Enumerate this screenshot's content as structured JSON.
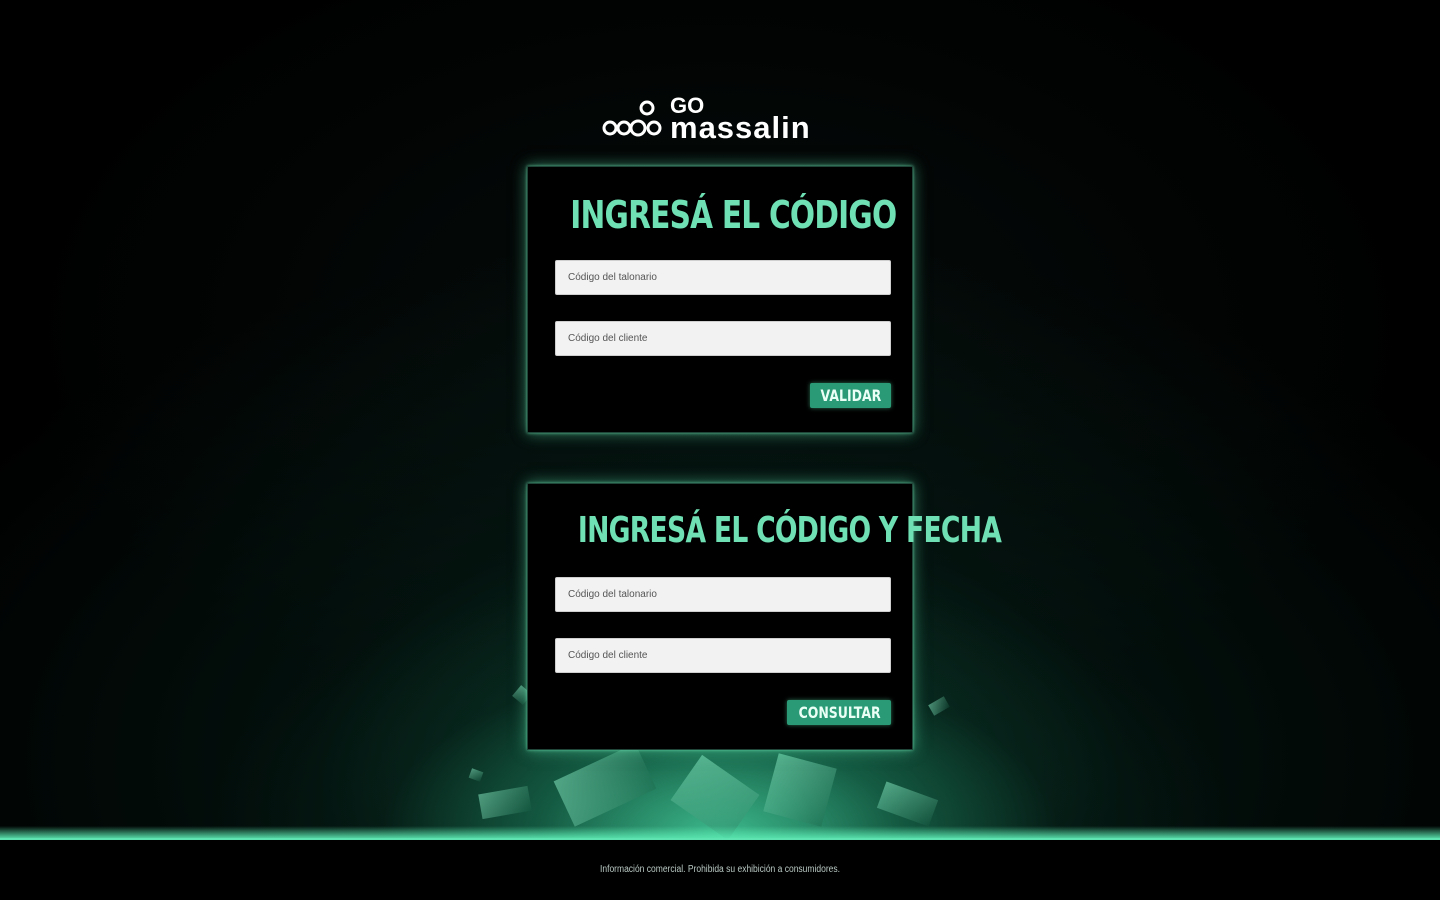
{
  "brand": {
    "logo_top": "GO",
    "logo_bottom": "massalin"
  },
  "card_code": {
    "title": "INGRESÁ EL CÓDIGO",
    "talonario_placeholder": "Código del talonario",
    "cliente_placeholder": "Código del cliente",
    "button_label": "VALIDAR"
  },
  "card_code_date": {
    "title": "INGRESÁ EL CÓDIGO Y FECHA",
    "talonario_placeholder": "Código del talonario",
    "cliente_placeholder": "Código del cliente",
    "button_label": "CONSULTAR"
  },
  "footer": {
    "text": "Información comercial. Prohibida su exhibición a consumidores."
  },
  "colors": {
    "accent": "#6fe0b4",
    "button": "#2a9a76",
    "background": "#000000"
  }
}
